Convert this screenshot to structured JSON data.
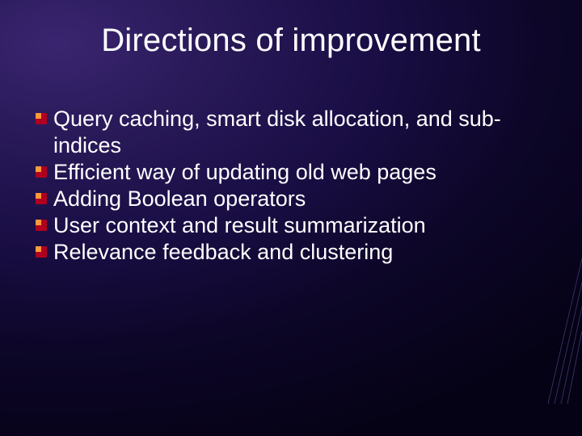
{
  "slide": {
    "title": "Directions of improvement",
    "bullets": [
      "Query caching, smart disk allocation, and sub-indices",
      "Efficient way of updating old web pages",
      "Adding Boolean operators",
      "User context and result summarization",
      "Relevance feedback and clustering"
    ]
  }
}
